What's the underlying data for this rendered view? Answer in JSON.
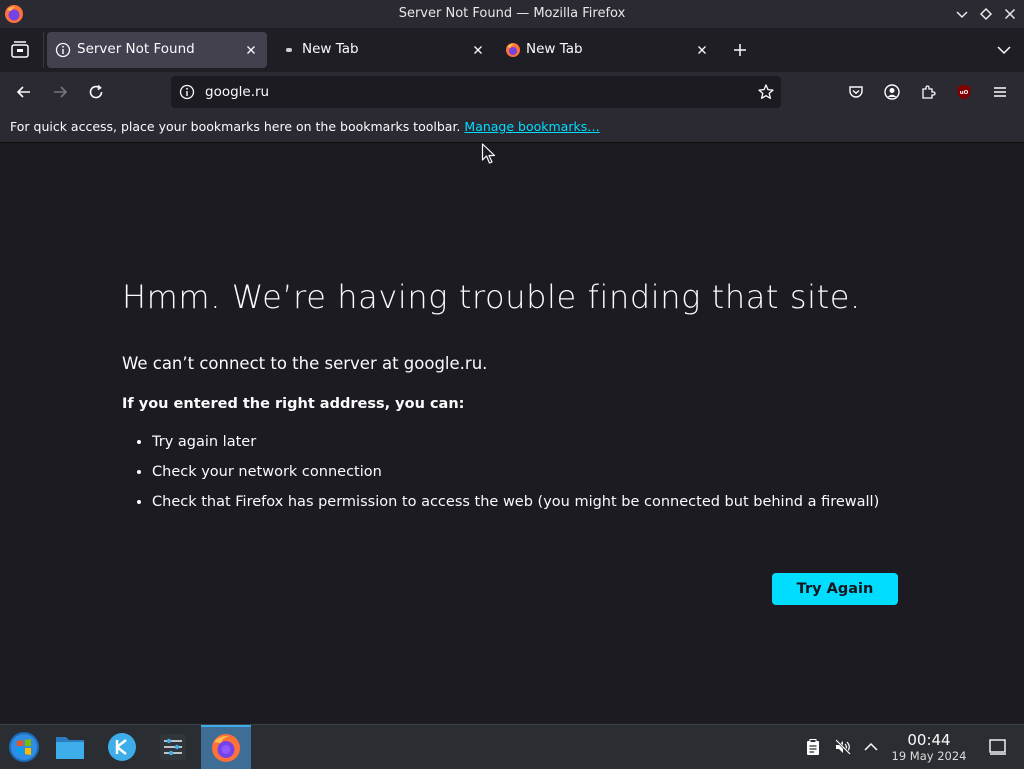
{
  "window": {
    "title": "Server Not Found — Mozilla Firefox"
  },
  "tabs": [
    {
      "label": "Server Not Found",
      "active": true,
      "icon": "info-icon"
    },
    {
      "label": "New Tab",
      "active": false,
      "icon": "dot-icon"
    },
    {
      "label": "New Tab",
      "active": false,
      "icon": "firefox-icon"
    }
  ],
  "urlbar": {
    "value": "google.ru"
  },
  "bookmarks": {
    "prompt": "For quick access, place your bookmarks here on the bookmarks toolbar.",
    "link": "Manage bookmarks…"
  },
  "error": {
    "title": "Hmm. We’re having trouble finding that site.",
    "description": "We can’t connect to the server at google.ru.",
    "subheading": "If you entered the right address, you can:",
    "tips": [
      "Try again later",
      "Check your network connection",
      "Check that Firefox has permission to access the web (you might be connected but behind a firewall)"
    ],
    "button": "Try Again"
  },
  "clock": {
    "time": "00:44",
    "date": "19 May 2024"
  },
  "colors": {
    "accent": "#00ddff",
    "background": "#1c1b22",
    "toolbar": "#2b2a33",
    "taskbar": "#2a2e32"
  }
}
